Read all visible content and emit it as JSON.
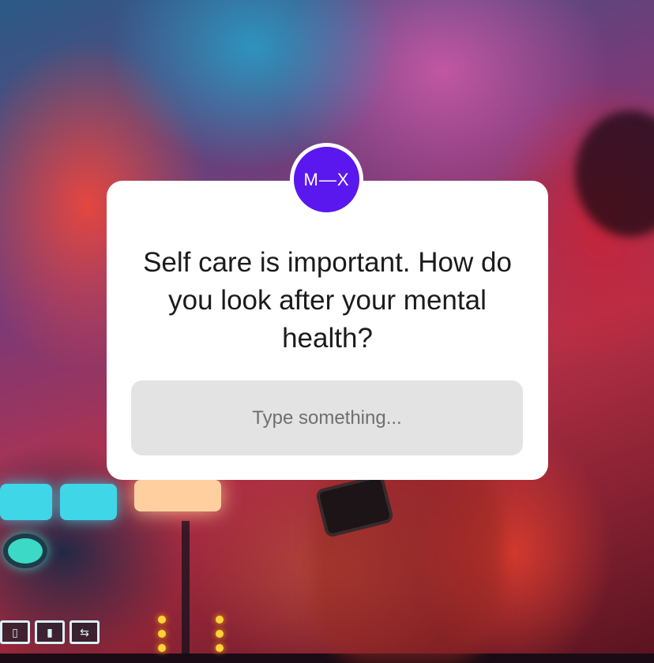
{
  "sticker": {
    "logo_text": "M—X",
    "question": "Self care is important. How do you look after your mental health?",
    "input_placeholder": "Type something...",
    "accent_color": "#5a18ee"
  },
  "background": {
    "controller_buttons": [
      "▯",
      "▮",
      "⇆"
    ]
  }
}
